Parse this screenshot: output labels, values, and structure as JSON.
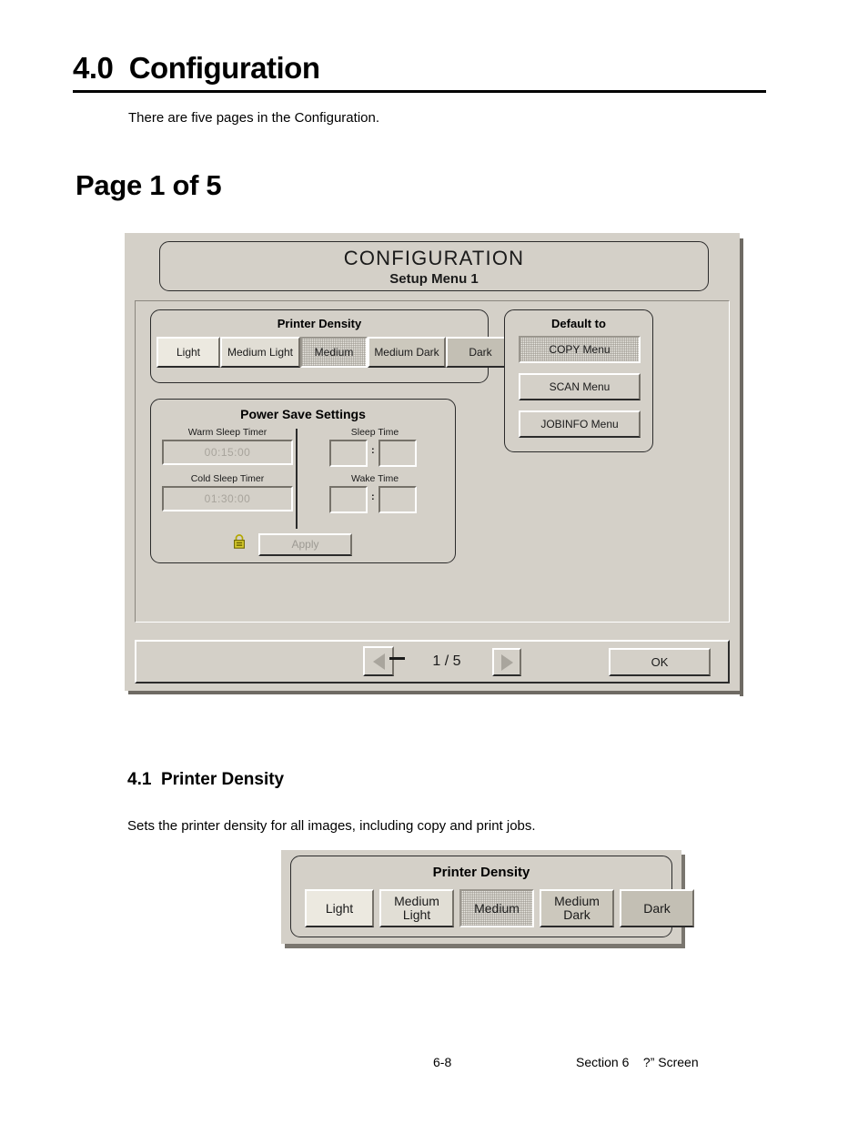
{
  "document": {
    "heading": "4.0  Configuration",
    "intro": "There are five pages in the Configuration.",
    "page_heading": "Page 1 of 5",
    "section_heading": "4.1  Printer Density",
    "section_body": "Sets the printer density for all images, including copy and print jobs.",
    "footer_page": "6-8",
    "footer_section": "Section 6    ?” Screen"
  },
  "device": {
    "header": {
      "title": "CONFIGURATION",
      "subtitle": "Setup Menu 1"
    },
    "printer_density": {
      "title": "Printer Density",
      "selected": "Medium",
      "options": [
        {
          "label": "Light",
          "swatch": "#ece9e0"
        },
        {
          "label": "Medium Light",
          "swatch": "#e1ded5"
        },
        {
          "label": "Medium",
          "swatch": "#eceae4"
        },
        {
          "label": "Medium Dark",
          "swatch": "#ccc8bd"
        },
        {
          "label": "Dark",
          "swatch": "#c3bfb4"
        }
      ]
    },
    "default_to": {
      "title": "Default to",
      "selected": "COPY Menu",
      "options": [
        {
          "label": "COPY Menu"
        },
        {
          "label": "SCAN Menu"
        },
        {
          "label": "JOBINFO Menu"
        }
      ]
    },
    "power_save": {
      "title": "Power Save Settings",
      "warm_sleep_timer": {
        "label": "Warm Sleep Timer",
        "value": "00:15:00"
      },
      "cold_sleep_timer": {
        "label": "Cold Sleep Timer",
        "value": "01:30:00"
      },
      "sleep_time": {
        "label": "Sleep Time",
        "hours": "",
        "minutes": "",
        "separator": ":"
      },
      "wake_time": {
        "label": "Wake Time",
        "hours": "",
        "minutes": "",
        "separator": ":"
      },
      "apply_label": "Apply",
      "locked_icon": "padlock-icon",
      "lock_color": "#b3a700"
    },
    "navigation": {
      "prev_icon": "triangle-left-icon",
      "next_icon": "triangle-right-icon",
      "counter": "1 / 5",
      "ok_label": "OK"
    },
    "colors": {
      "face": "#d4d0c8",
      "shadow": "#76726a",
      "highlight": "#ffffff",
      "text": "#1a1a1a"
    }
  },
  "figure_density": {
    "title": "Printer Density",
    "selected": "Medium",
    "options": [
      {
        "label": "Light",
        "swatch": "#ece9e0"
      },
      {
        "label": "Medium\nLight",
        "swatch": "#e1ded5"
      },
      {
        "label": "Medium",
        "swatch": "#eceae4"
      },
      {
        "label": "Medium\nDark",
        "swatch": "#ccc8bd"
      },
      {
        "label": "Dark",
        "swatch": "#c3bfb4"
      }
    ]
  }
}
